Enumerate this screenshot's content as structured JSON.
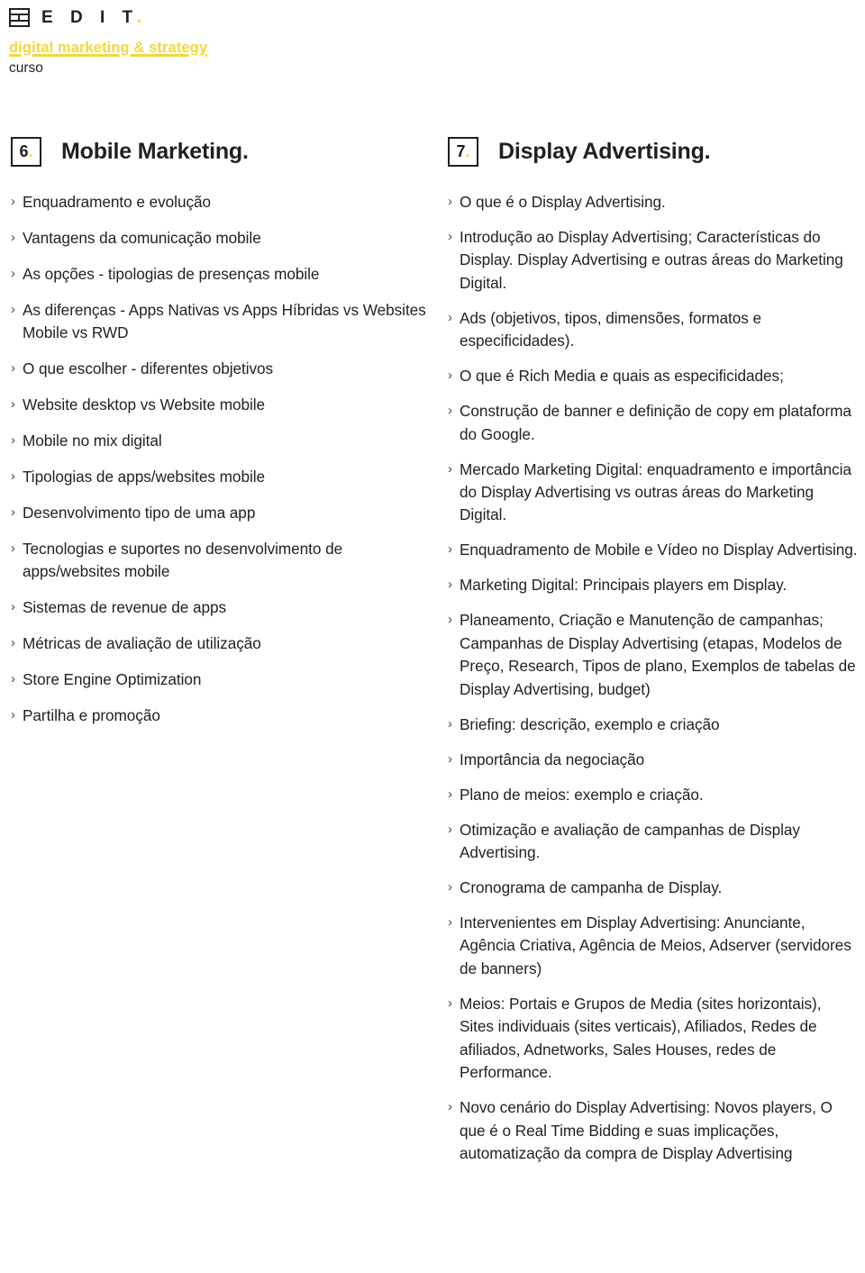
{
  "brand": {
    "logo_icon": "edit-logo-icon",
    "logo_word": "E D I T",
    "logo_dot": ".",
    "course_title": "digital marketing & strategy",
    "course_kind": "curso",
    "accent_color": "#f2d83a",
    "text_color": "#231f20"
  },
  "sections": [
    {
      "number": "6",
      "number_dot": ".",
      "title": "Mobile Marketing.",
      "items": [
        "Enquadramento e evolução",
        "Vantagens da comunicação mobile",
        "As opções - tipologias de presenças mobile",
        "As diferenças - Apps Nativas vs Apps Híbridas vs Websites Mobile vs RWD",
        "O que escolher - diferentes objetivos",
        "Website desktop vs Website mobile",
        "Mobile no mix digital",
        "Tipologias de apps/websites mobile",
        "Desenvolvimento tipo de uma app",
        "Tecnologias e suportes no desenvolvimento de apps/websites mobile",
        "Sistemas de revenue de apps",
        "Métricas de avaliação de utilização",
        "Store Engine Optimization",
        "Partilha e promoção"
      ]
    },
    {
      "number": "7",
      "number_dot": ".",
      "title": "Display Advertising.",
      "items": [
        "O que é o Display Advertising.",
        "Introdução ao Display Advertising; Características do Display. Display Advertising e outras áreas do Marketing Digital.",
        "Ads (objetivos, tipos, dimensões, formatos e especificidades).",
        "O que é Rich Media e quais as especificidades;",
        "Construção de banner e definição de copy em plataforma do Google.",
        "Mercado Marketing Digital: enquadramento e importância do Display Advertising vs outras áreas do Marketing Digital.",
        "Enquadramento de Mobile e Vídeo no Display Advertising.",
        "Marketing Digital: Principais players  em Display.",
        "Planeamento, Criação e Manutenção de campanhas; Campanhas de Display Advertising (etapas, Modelos de Preço, Research, Tipos de plano, Exemplos de tabelas de Display Advertising, budget)",
        "Briefing: descrição, exemplo e criação",
        "Importância da negociação",
        "Plano de meios: exemplo e criação.",
        "Otimização e avaliação de campanhas de Display Advertising.",
        "Cronograma de campanha de Display.",
        "Intervenientes em Display Advertising: Anunciante, Agência Criativa, Agência de Meios, Adserver (servidores de banners)",
        "Meios: Portais e Grupos de Media (sites horizontais), Sites individuais (sites verticais), Afiliados, Redes de afiliados, Adnetworks, Sales Houses, redes de Performance.",
        "Novo cenário do Display Advertising: Novos players, O que é o Real Time Bidding e suas implicações, automatização da compra de Display Advertising"
      ]
    }
  ],
  "bullet_glyph": "›"
}
